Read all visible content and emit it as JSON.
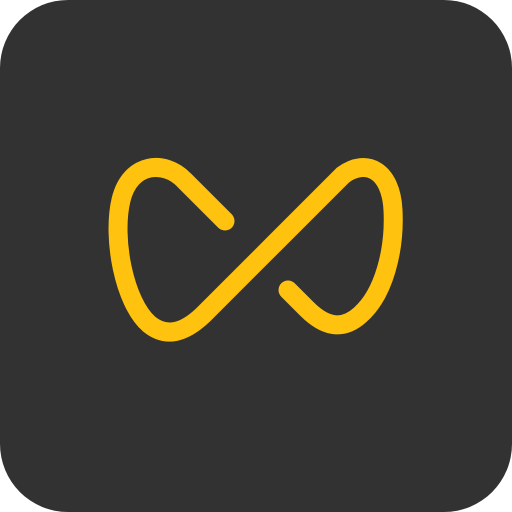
{
  "app_icon": {
    "icon": "infinity-icon",
    "colors": {
      "background": "#323232",
      "stroke": "#FFC20E"
    }
  }
}
